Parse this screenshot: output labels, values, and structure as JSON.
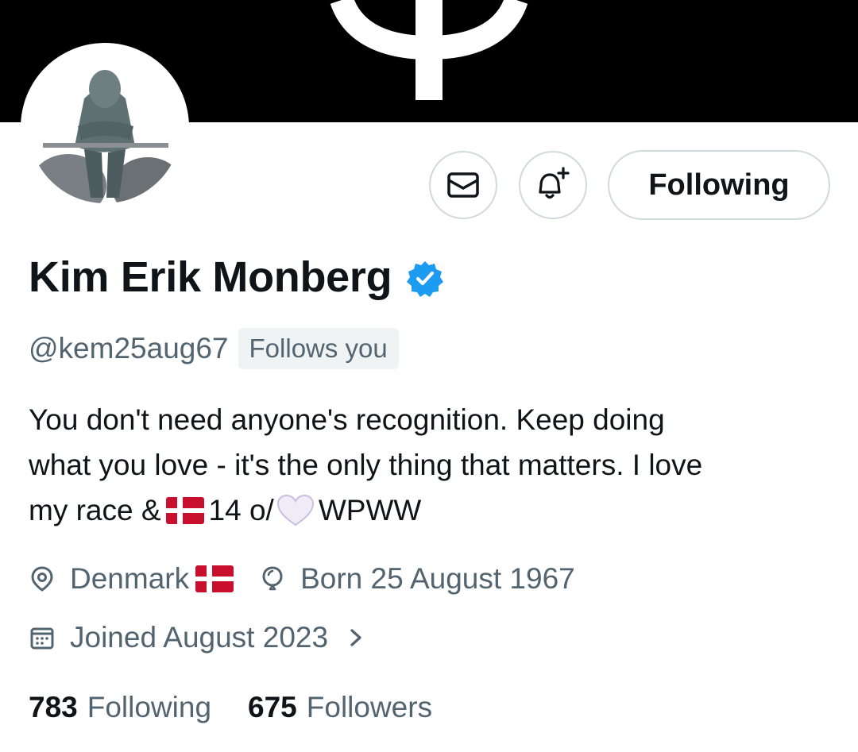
{
  "profile": {
    "display_name": "Kim Erik Monberg",
    "handle": "@kem25aug67",
    "follows_you_badge": "Follows you",
    "verified": true,
    "bio": {
      "line1": "You don't need anyone's recognition.  Keep doing",
      "line2": "what you love - it's the only thing that matters. I love",
      "line3_before_flag": "my race &",
      "line3_after_flag": "14 o/",
      "line3_end": "WPWW"
    },
    "location": "Denmark",
    "birthday": "Born 25 August 1967",
    "joined": "Joined August 2023"
  },
  "actions": {
    "message_icon": "envelope-icon",
    "notify_icon": "bell-plus-icon",
    "following_label": "Following"
  },
  "stats": {
    "following_count": "783",
    "following_label": "Following",
    "followers_count": "675",
    "followers_label": "Followers"
  },
  "colors": {
    "verified_blue": "#1d9bf0",
    "secondary_text": "#536471",
    "border": "#cfd9de",
    "flag_red": "#c8102e"
  }
}
